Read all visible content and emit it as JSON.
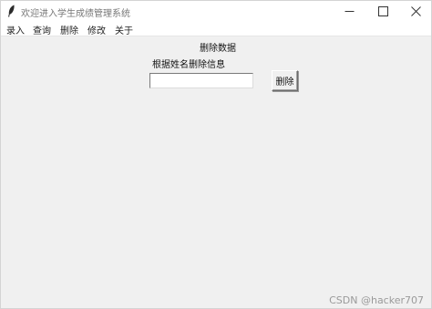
{
  "window": {
    "title": "欢迎进入学生成绩管理系统",
    "icon": "feather-icon",
    "controls": [
      "minimize-icon",
      "maximize-icon",
      "close-icon"
    ]
  },
  "menu": {
    "items": [
      {
        "label": "录入"
      },
      {
        "label": "查询"
      },
      {
        "label": "删除"
      },
      {
        "label": "修改"
      },
      {
        "label": "关于"
      }
    ]
  },
  "form": {
    "heading": "删除数据",
    "label": "根据姓名删除信息",
    "name_value": "",
    "delete_label": "删除"
  },
  "watermark": "CSDN @hacker707"
}
